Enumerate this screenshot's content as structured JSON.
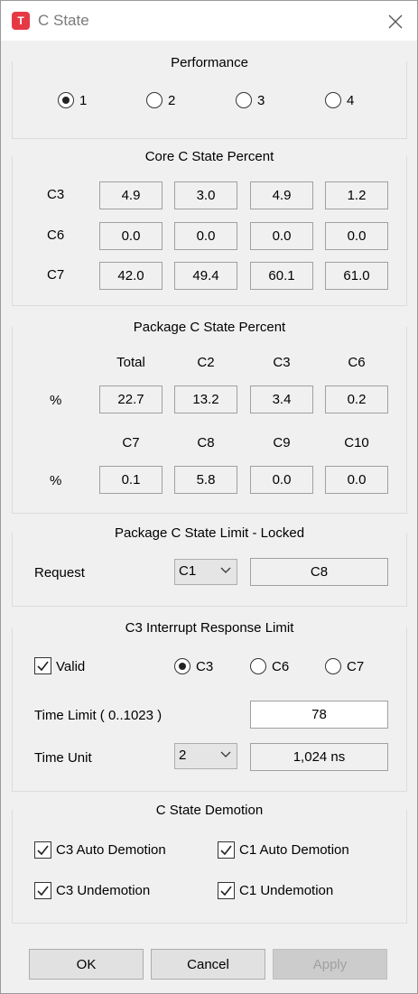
{
  "window": {
    "title": "C State",
    "app_icon_letter": "T"
  },
  "performance": {
    "title": "Performance",
    "options": [
      "1",
      "2",
      "3",
      "4"
    ],
    "selected": "1"
  },
  "core_c_state": {
    "title": "Core C State Percent",
    "rows": [
      {
        "label": "C3",
        "values": [
          "4.9",
          "3.0",
          "4.9",
          "1.2"
        ]
      },
      {
        "label": "C6",
        "values": [
          "0.0",
          "0.0",
          "0.0",
          "0.0"
        ]
      },
      {
        "label": "C7",
        "values": [
          "42.0",
          "49.4",
          "60.1",
          "61.0"
        ]
      }
    ]
  },
  "package_c_state": {
    "title": "Package C State Percent",
    "headers1": [
      "Total",
      "C2",
      "C3",
      "C6"
    ],
    "row1_label": "%",
    "row1_values": [
      "22.7",
      "13.2",
      "3.4",
      "0.2"
    ],
    "headers2": [
      "C7",
      "C8",
      "C9",
      "C10"
    ],
    "row2_label": "%",
    "row2_values": [
      "0.1",
      "5.8",
      "0.0",
      "0.0"
    ]
  },
  "package_limit": {
    "title": "Package C State Limit - Locked",
    "request_label": "Request",
    "request_combo": "C1",
    "current_value": "C8"
  },
  "c3_interrupt": {
    "title": "C3 Interrupt Response Limit",
    "valid_label": "Valid",
    "valid_checked": true,
    "radio_options": [
      "C3",
      "C6",
      "C7"
    ],
    "radio_selected": "C3",
    "time_limit_label": "Time Limit  ( 0..1023 )",
    "time_limit_value": "78",
    "time_unit_label": "Time Unit",
    "time_unit_combo": "2",
    "time_unit_value": "1,024 ns"
  },
  "demotion": {
    "title": "C State Demotion",
    "c3_auto": "C3 Auto Demotion",
    "c1_auto": "C1 Auto Demotion",
    "c3_undemotion": "C3 Undemotion",
    "c1_undemotion": "C1 Undemotion"
  },
  "buttons": {
    "ok": "OK",
    "cancel": "Cancel",
    "apply": "Apply"
  },
  "colors": {
    "app_icon": "#e63946",
    "background": "#f0f0f0"
  },
  "icons": [
    "app-icon",
    "close-icon",
    "checkmark-icon",
    "chevron-down-icon"
  ]
}
